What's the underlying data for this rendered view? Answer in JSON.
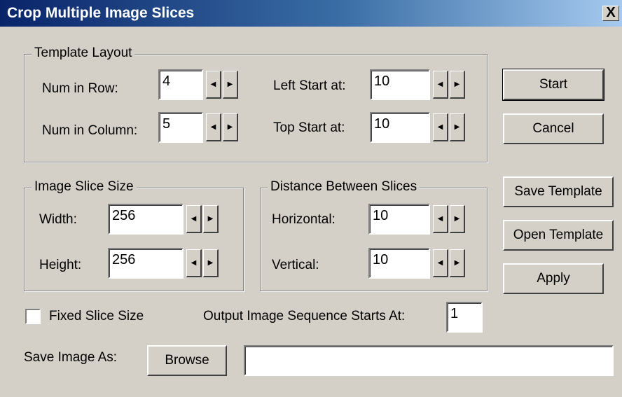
{
  "window": {
    "title": "Crop Multiple Image Slices",
    "close_symbol": "X"
  },
  "template_layout": {
    "title": "Template Layout",
    "num_in_row_label": "Num in Row:",
    "num_in_row": "4",
    "num_in_column_label": "Num in Column:",
    "num_in_column": "5",
    "left_start_label": "Left Start at:",
    "left_start": "10",
    "top_start_label": "Top Start at:",
    "top_start": "10"
  },
  "slice_size": {
    "title": "Image Slice Size",
    "width_label": "Width:",
    "width": "256",
    "height_label": "Height:",
    "height": "256"
  },
  "distance": {
    "title": "Distance Between Slices",
    "horizontal_label": "Horizontal:",
    "horizontal": "10",
    "vertical_label": "Vertical:",
    "vertical": "10"
  },
  "buttons": {
    "start": "Start",
    "cancel": "Cancel",
    "save_template": "Save Template",
    "open_template": "Open Template",
    "apply": "Apply",
    "browse": "Browse"
  },
  "fixed_slice_size": {
    "label": "Fixed Slice Size",
    "checked": false
  },
  "sequence": {
    "label": "Output Image Sequence Starts At:",
    "value": "1"
  },
  "save_as": {
    "label": "Save Image As:",
    "path": ""
  },
  "icons": {
    "spin_left": "◀",
    "spin_right": "▶"
  }
}
